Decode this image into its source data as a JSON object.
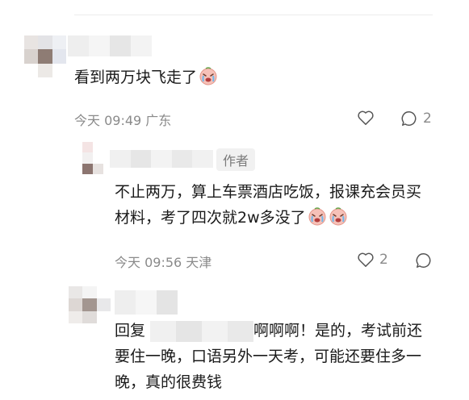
{
  "comments": [
    {
      "text": "看到两万块飞走了",
      "time": "今天 09:49",
      "location": "广东",
      "like_count": "",
      "reply_count": "2"
    },
    {
      "author_badge": "作者",
      "text": "不止两万，算上车票酒店吃饭，报课充会员买材料，考了四次就2w多没了",
      "time": "今天 09:56",
      "location": "天津",
      "like_count": "2",
      "reply_count": ""
    },
    {
      "reply_prefix": "回复",
      "text_after": "啊啊啊！是的，考试前还要住一晚，口语另外一天考，可能还要住多一晚，真的很费钱"
    }
  ],
  "icons": {
    "emoji": "crying-face-emoji",
    "like": "heart-outline-icon",
    "reply": "speech-bubble-icon"
  },
  "colors": {
    "meta": "#8a8a8a",
    "badge_bg": "#f1f1f1"
  }
}
